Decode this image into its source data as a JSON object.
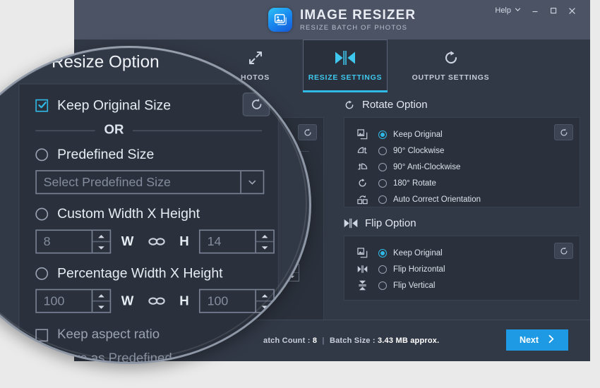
{
  "window": {
    "title": "IMAGE RESIZER",
    "subtitle": "RESIZE BATCH OF PHOTOS",
    "logo_icon": "image-photo-icon",
    "help_label": "Help",
    "help_caret_icon": "chevron-down-icon",
    "minimize_icon": "minimize-icon",
    "maximize_icon": "maximize-icon",
    "close_icon": "close-icon"
  },
  "tabs": [
    {
      "label": "HOTOS",
      "icon": "resize-arrows-icon",
      "active": false
    },
    {
      "label": "RESIZE SETTINGS",
      "icon": "flip-horizontal-icon",
      "active": true
    },
    {
      "label": "OUTPUT SETTINGS",
      "icon": "rotate-clockwise-icon",
      "active": false
    }
  ],
  "resize_panel": {
    "title": "Resize Option",
    "icon": "resize-corner-icon",
    "reset_icon": "reset-icon",
    "keep_original": {
      "label": "Keep Original Size",
      "checked": true
    },
    "or_label": "OR",
    "predefined": {
      "label": "Predefined Size",
      "selected": false,
      "placeholder": "Select Predefined Size",
      "dropdown_icon": "caret-down-icon"
    },
    "custom": {
      "label": "Custom Width X Height",
      "selected": false,
      "width_value": "8",
      "height_value": "14",
      "w_label": "W",
      "h_label": "H",
      "link_icon": "link-chain-icon"
    },
    "percentage": {
      "label": "Percentage Width X Height",
      "selected": false,
      "width_value": "100",
      "height_value": "100",
      "w_label": "W",
      "h_label": "H",
      "link_icon": "link-chain-icon"
    },
    "keep_aspect_ratio": {
      "label": "Keep aspect ratio",
      "checked": false
    },
    "save_as_predefined": {
      "label": "Save as Predefined",
      "checked": false
    }
  },
  "rotate_panel": {
    "title": "Rotate Option",
    "icon": "rotate-clockwise-icon",
    "reset_icon": "reset-icon",
    "options": [
      {
        "label": "Keep Original",
        "icon": "image-original-icon",
        "selected": true
      },
      {
        "label": "90° Clockwise",
        "icon": "rotate-90-cw-icon",
        "selected": false
      },
      {
        "label": "90° Anti-Clockwise",
        "icon": "rotate-90-ccw-icon",
        "selected": false
      },
      {
        "label": "180° Rotate",
        "icon": "rotate-180-icon",
        "selected": false
      },
      {
        "label": "Auto Correct Orientation",
        "icon": "auto-orient-icon",
        "selected": false
      }
    ]
  },
  "flip_panel": {
    "title": "Flip Option",
    "icon": "flip-horizontal-icon",
    "reset_icon": "reset-icon",
    "options": [
      {
        "label": "Keep Original",
        "icon": "image-original-icon",
        "selected": true
      },
      {
        "label": "Flip Horizontal",
        "icon": "flip-horizontal-icon",
        "selected": false
      },
      {
        "label": "Flip Vertical",
        "icon": "flip-vertical-icon",
        "selected": false
      }
    ]
  },
  "status": {
    "batch_count_label": "atch Count :",
    "batch_count_value": "8",
    "separator": "|",
    "batch_size_label": "Batch Size :",
    "batch_size_value": "3.43 MB approx.",
    "next_label": "Next",
    "next_icon": "chevron-right-icon"
  },
  "colors": {
    "accent": "#2fb9e6",
    "next_button": "#1e9ae4",
    "titlebar": "#4b5365",
    "window_bg": "#323946",
    "card_bg": "#2b313c",
    "desktop_bg": "#eaeaea"
  }
}
